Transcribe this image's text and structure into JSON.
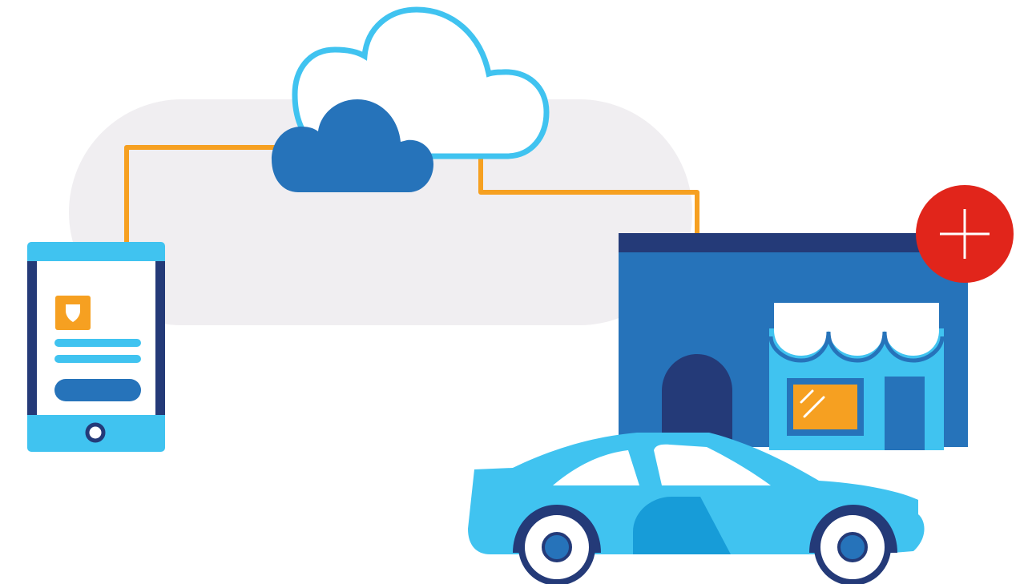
{
  "illustration": {
    "subject": "connected-services",
    "colors": {
      "background_pill": "#F0EEF1",
      "cloud_outline": "#40C3F0",
      "cloud_fill": "#2673BA",
      "connector_line": "#F6A021",
      "phone_frame": "#243A78",
      "phone_accent": "#40C3F0",
      "phone_screen": "#FFFFFF",
      "phone_icon": "#F6A021",
      "phone_button": "#2673BA",
      "store_wall": "#2673BA",
      "store_roof": "#243A78",
      "store_door": "#243A78",
      "store_front": "#40C3F0",
      "store_window": "#F6A021",
      "badge_fill": "#E1251B",
      "badge_symbol": "#FFFFFF",
      "car_body": "#40C3F0",
      "car_shade": "#179CD8",
      "car_tire": "#243A78",
      "car_hub": "#2673BA"
    },
    "icons": [
      "cloud-icon",
      "smartphone-icon",
      "shield-icon",
      "storefront-icon",
      "plus-icon",
      "car-icon"
    ]
  }
}
